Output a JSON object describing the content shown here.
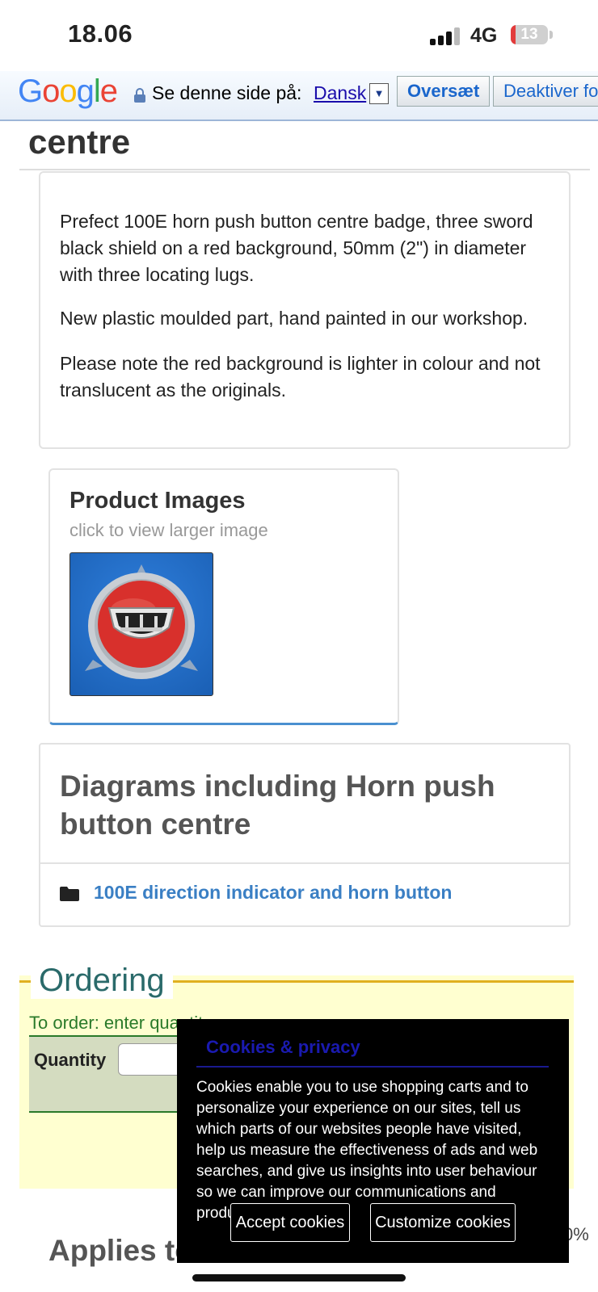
{
  "status_bar": {
    "time": "18.06",
    "network": "4G",
    "battery": "13",
    "battery_level_pct": 13
  },
  "translate_bar": {
    "logo": "Google",
    "prompt": "Se denne side på:",
    "language": "Dansk",
    "translate_button": "Oversæt",
    "disable_button": "Deaktiver fo"
  },
  "page": {
    "title": "centre",
    "description": [
      "Prefect 100E horn push button centre badge, three sword black shield on a red background, 50mm (2\") in diameter with three locating lugs.",
      "New plastic moulded part, hand painted in our workshop.",
      "Please note the red background is lighter in colour and not translucent as the originals."
    ],
    "product_images": {
      "title": "Product Images",
      "subtitle": "click to view larger image"
    },
    "diagrams": {
      "title": "Diagrams including Horn push button centre",
      "link": "100E direction indicator and horn button"
    },
    "ordering": {
      "title": "Ordering",
      "instruction": "To order: enter quantity & click 'Add'",
      "quantity_label": "Quantity",
      "quantity_value": ""
    },
    "applies_to": "Applies to",
    "percent_fragment": "0%"
  },
  "cookie_modal": {
    "title": "Cookies & privacy",
    "text": "Cookies enable you to use shopping carts and to personalize your experience on our sites, tell us which parts of our websites people have visited, help us measure the effectiveness of ads and web searches, and give us insights into user behaviour so we can improve our communications and products.",
    "accept": "Accept cookies",
    "customize": "Customize cookies"
  }
}
